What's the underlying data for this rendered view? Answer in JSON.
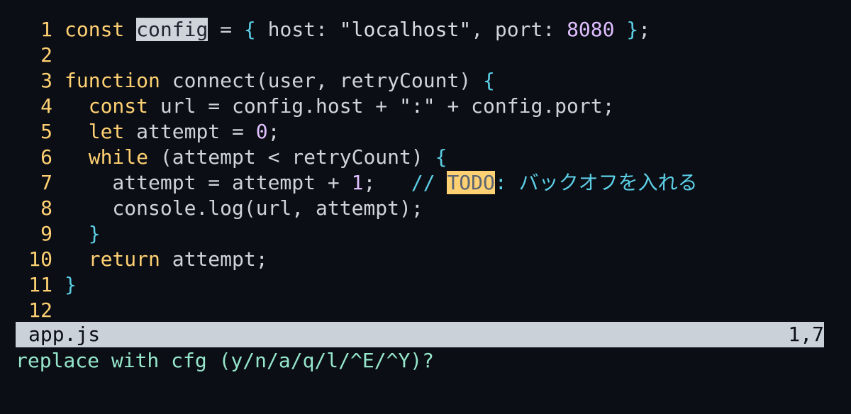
{
  "file": {
    "name": "app.js",
    "cursor": "1,7"
  },
  "prompt": "replace with cfg (y/n/a/q/l/^E/^Y)?",
  "lines": [
    {
      "n": "1",
      "tokens": [
        {
          "t": "const",
          "c": "kw"
        },
        {
          "t": " ",
          "c": "punc"
        },
        {
          "t": "config",
          "c": "search-hl"
        },
        {
          "t": " = ",
          "c": "punc"
        },
        {
          "t": "{",
          "c": "brace"
        },
        {
          "t": " host: ",
          "c": "punc"
        },
        {
          "t": "\"localhost\"",
          "c": "str2"
        },
        {
          "t": ", port: ",
          "c": "punc"
        },
        {
          "t": "8080",
          "c": "num"
        },
        {
          "t": " ",
          "c": "punc"
        },
        {
          "t": "}",
          "c": "brace"
        },
        {
          "t": ";",
          "c": "punc"
        }
      ]
    },
    {
      "n": "2",
      "tokens": []
    },
    {
      "n": "3",
      "tokens": [
        {
          "t": "function",
          "c": "kw"
        },
        {
          "t": " connect(user, retryCount) ",
          "c": "punc"
        },
        {
          "t": "{",
          "c": "brace"
        }
      ]
    },
    {
      "n": "4",
      "tokens": [
        {
          "t": "  ",
          "c": "punc"
        },
        {
          "t": "const",
          "c": "kw"
        },
        {
          "t": " url = config.host + ",
          "c": "punc"
        },
        {
          "t": "\":\"",
          "c": "str2"
        },
        {
          "t": " + config.port;",
          "c": "punc"
        }
      ]
    },
    {
      "n": "5",
      "tokens": [
        {
          "t": "  ",
          "c": "punc"
        },
        {
          "t": "let",
          "c": "kw"
        },
        {
          "t": " attempt = ",
          "c": "punc"
        },
        {
          "t": "0",
          "c": "num"
        },
        {
          "t": ";",
          "c": "punc"
        }
      ]
    },
    {
      "n": "6",
      "tokens": [
        {
          "t": "  ",
          "c": "punc"
        },
        {
          "t": "while",
          "c": "kw"
        },
        {
          "t": " (attempt < retryCount) ",
          "c": "punc"
        },
        {
          "t": "{",
          "c": "brace"
        }
      ]
    },
    {
      "n": "7",
      "tokens": [
        {
          "t": "    attempt = attempt + ",
          "c": "punc"
        },
        {
          "t": "1",
          "c": "num"
        },
        {
          "t": ";   ",
          "c": "punc"
        },
        {
          "t": "// ",
          "c": "comment"
        },
        {
          "t": "TODO",
          "c": "todo"
        },
        {
          "t": ": バックオフを入れる",
          "c": "comment"
        }
      ]
    },
    {
      "n": "8",
      "tokens": [
        {
          "t": "    console.log(url, attempt);",
          "c": "punc"
        }
      ]
    },
    {
      "n": "9",
      "tokens": [
        {
          "t": "  ",
          "c": "punc"
        },
        {
          "t": "}",
          "c": "brace"
        }
      ]
    },
    {
      "n": "10",
      "tokens": [
        {
          "t": "  ",
          "c": "punc"
        },
        {
          "t": "return",
          "c": "kw"
        },
        {
          "t": " attempt;",
          "c": "punc"
        }
      ]
    },
    {
      "n": "11",
      "tokens": [
        {
          "t": "}",
          "c": "brace"
        }
      ]
    },
    {
      "n": "12",
      "tokens": []
    }
  ]
}
